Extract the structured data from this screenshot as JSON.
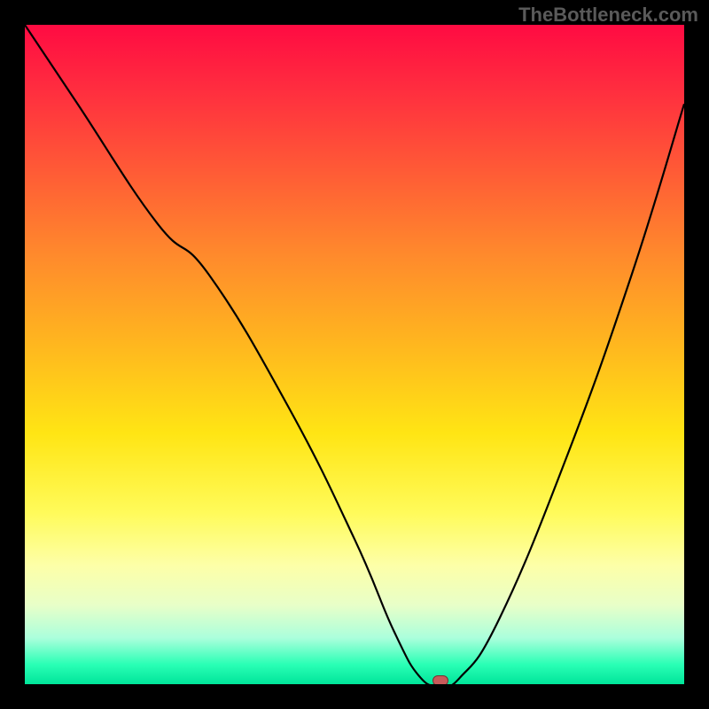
{
  "watermark": "TheBottleneck.com",
  "chart_data": {
    "type": "line",
    "title": "",
    "xlabel": "",
    "ylabel": "",
    "xlim": [
      0,
      100
    ],
    "ylim": [
      0,
      100
    ],
    "grid": false,
    "series": [
      {
        "name": "curve",
        "x": [
          0,
          8,
          20,
          28,
          40,
          50,
          56,
          60,
          63,
          66,
          72,
          82,
          92,
          100
        ],
        "y": [
          100,
          88,
          70,
          62,
          42,
          22,
          8,
          1,
          0,
          1,
          10,
          34,
          62,
          88
        ]
      }
    ],
    "marker": {
      "x": 63,
      "y": 0.6,
      "color": "#c75a5a"
    },
    "gradient_stops": [
      {
        "pct": 0,
        "color": "#ff0b42"
      },
      {
        "pct": 62,
        "color": "#ffe514"
      },
      {
        "pct": 100,
        "color": "#00e59a"
      }
    ]
  }
}
